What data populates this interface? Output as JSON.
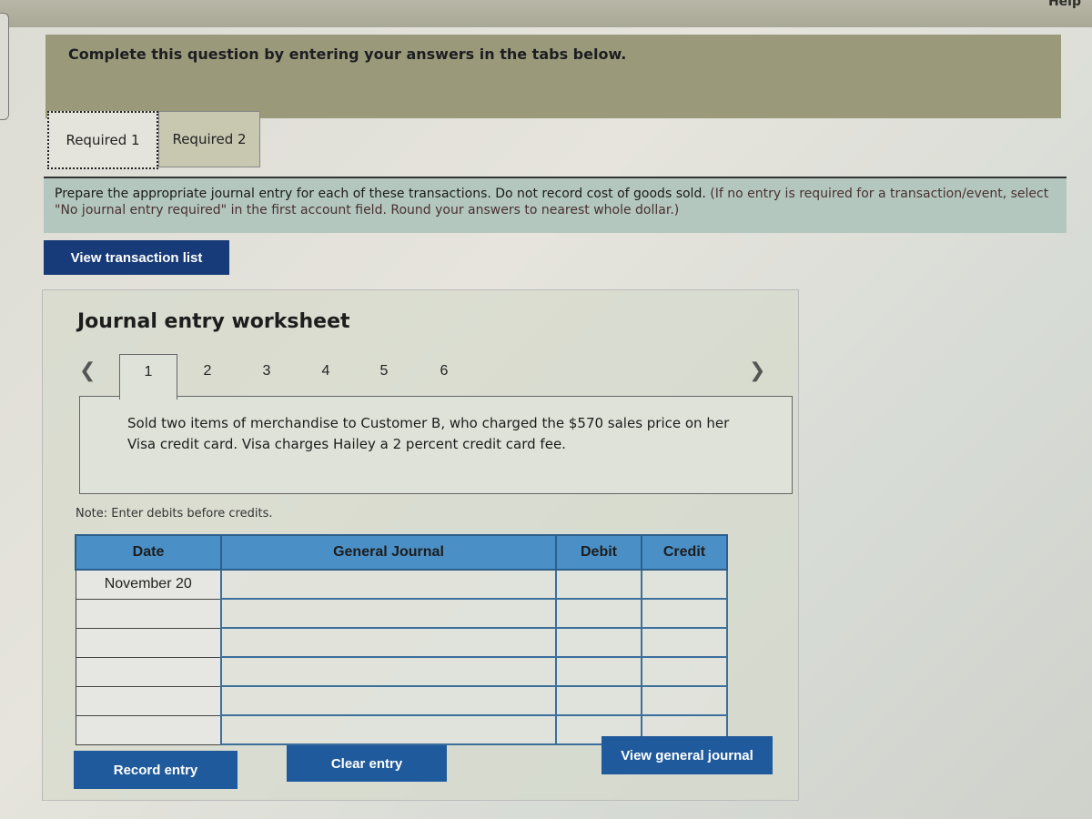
{
  "header": {
    "help_label": "Help"
  },
  "banner": {
    "text": "Complete this question by entering your answers in the tabs below."
  },
  "tabs": [
    {
      "label": "Required 1",
      "active": true
    },
    {
      "label": "Required 2",
      "active": false
    }
  ],
  "instructions": {
    "main": "Prepare the appropriate journal entry for each of these transactions. Do not record cost of goods sold.",
    "paren": "(If no entry is required for a transaction/event, select \"No journal entry required\" in the first account field. Round your answers to nearest whole dollar.)"
  },
  "view_transaction_list_label": "View transaction list",
  "worksheet": {
    "title": "Journal entry worksheet",
    "prev_icon": "chevron-left",
    "next_icon": "chevron-right",
    "pages": [
      "1",
      "2",
      "3",
      "4",
      "5",
      "6"
    ],
    "active_page": "1",
    "description": "Sold two items of merchandise to Customer B, who charged the $570 sales price on her Visa credit card. Visa charges Hailey a 2 percent credit card fee.",
    "note": "Note: Enter debits before credits.",
    "table": {
      "headers": {
        "date": "Date",
        "journal": "General Journal",
        "debit": "Debit",
        "credit": "Credit"
      },
      "rows": [
        {
          "date": "November 20",
          "account": "",
          "debit": "",
          "credit": ""
        },
        {
          "date": "",
          "account": "",
          "debit": "",
          "credit": ""
        },
        {
          "date": "",
          "account": "",
          "debit": "",
          "credit": ""
        },
        {
          "date": "",
          "account": "",
          "debit": "",
          "credit": ""
        },
        {
          "date": "",
          "account": "",
          "debit": "",
          "credit": ""
        },
        {
          "date": "",
          "account": "",
          "debit": "",
          "credit": ""
        }
      ]
    },
    "buttons": {
      "record": "Record entry",
      "clear": "Clear entry",
      "view_general_journal": "View general journal"
    }
  }
}
